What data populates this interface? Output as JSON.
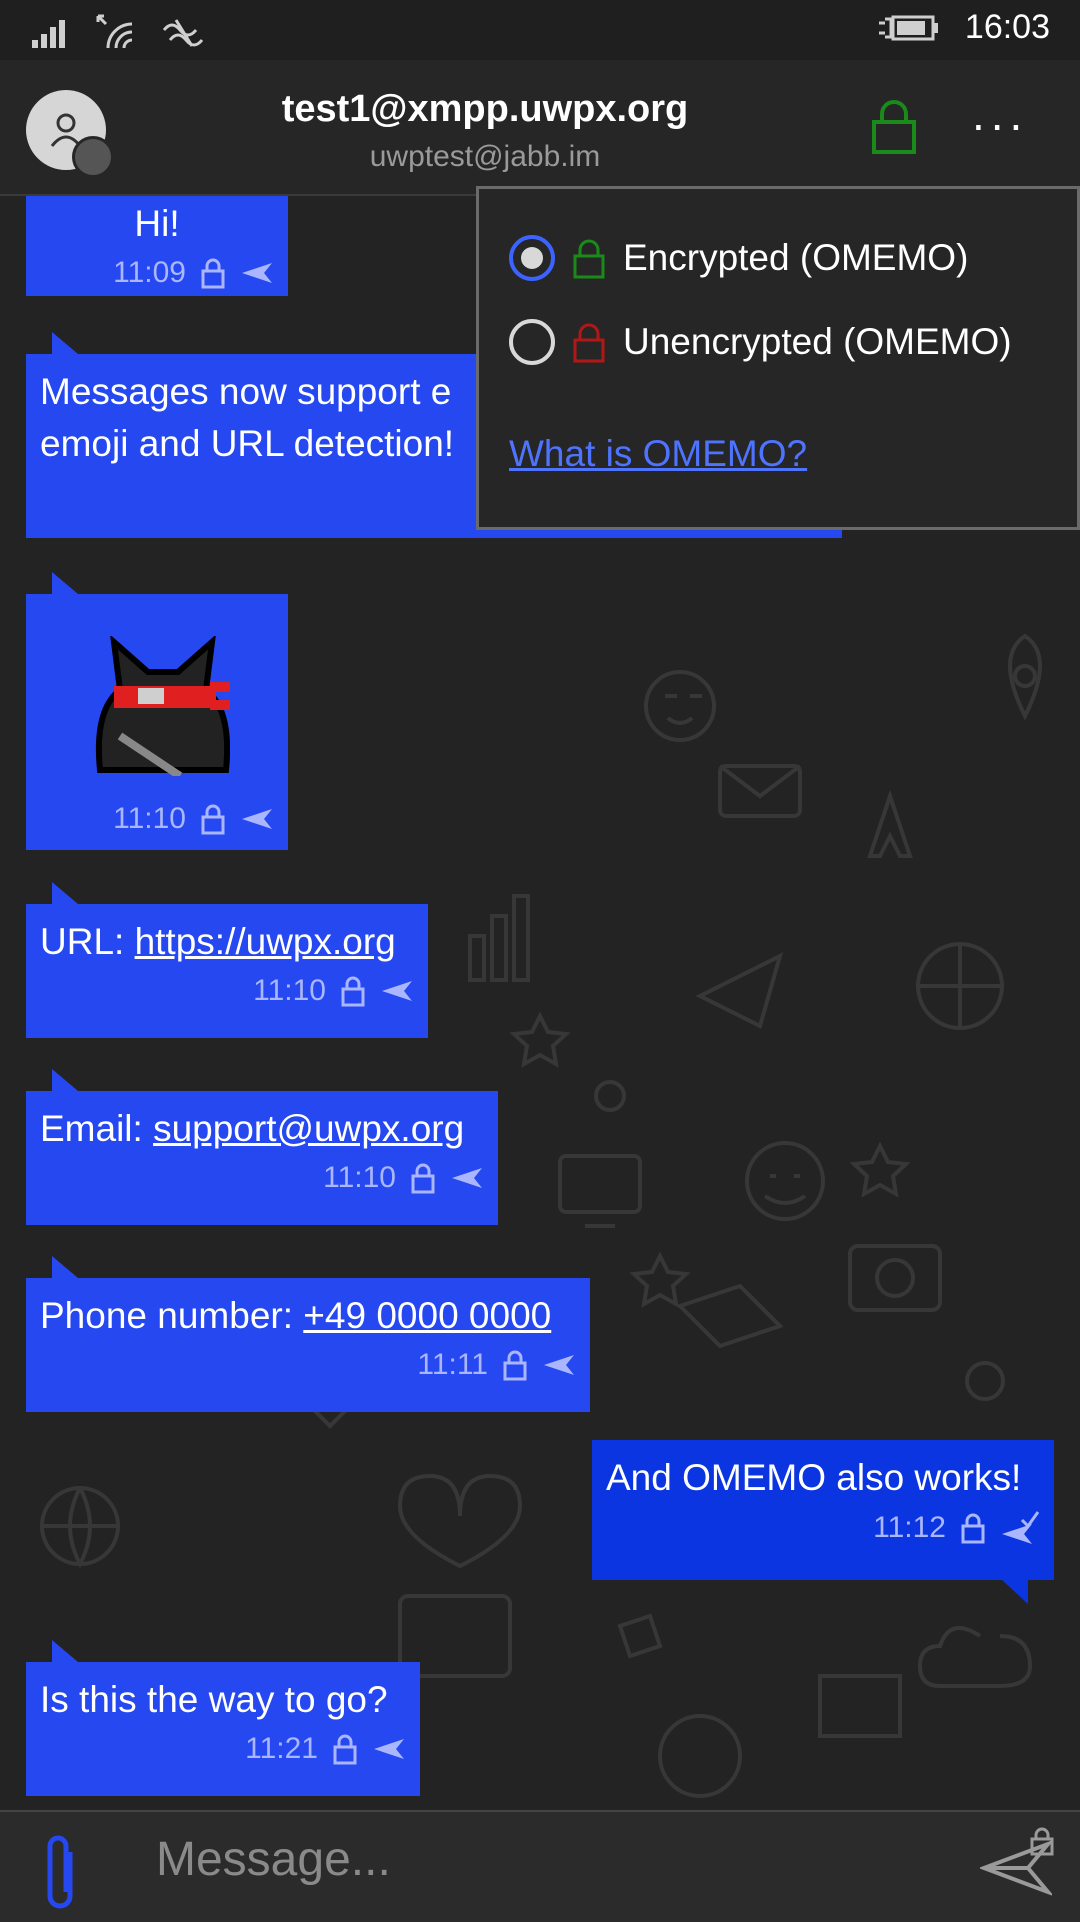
{
  "status_bar": {
    "time": "16:03"
  },
  "header": {
    "title": "test1@xmpp.uwpx.org",
    "subtitle": "uwptest@jabb.im",
    "more_label": "..."
  },
  "messages": [
    {
      "text": "Hi!",
      "time": "11:09"
    },
    {
      "text_line1": "Messages now support e",
      "text_line2": "emoji and URL detection!",
      "time": ""
    },
    {
      "time": "11:10"
    },
    {
      "prefix": "URL: ",
      "link": "https://uwpx.org",
      "time": "11:10"
    },
    {
      "prefix": "Email: ",
      "link": "support@uwpx.org",
      "time": "11:10"
    },
    {
      "prefix": "Phone number: ",
      "link": "+49 0000 0000",
      "time": "11:11"
    },
    {
      "text": "And OMEMO also works!",
      "time": "11:12"
    },
    {
      "text": "Is this the way to go?",
      "time": "11:21"
    }
  ],
  "encryption_menu": {
    "options": [
      {
        "label": "Encrypted (OMEMO)",
        "selected": true,
        "lock_color": "#1a8a1a"
      },
      {
        "label": "Unencrypted (OMEMO)",
        "selected": false,
        "lock_color": "#b01818"
      }
    ],
    "link": "What is OMEMO?"
  },
  "composer": {
    "placeholder": "Message..."
  },
  "colors": {
    "bubble_in": "#2548f0",
    "bubble_out": "#0a35e0",
    "accent": "#3d63ff"
  }
}
